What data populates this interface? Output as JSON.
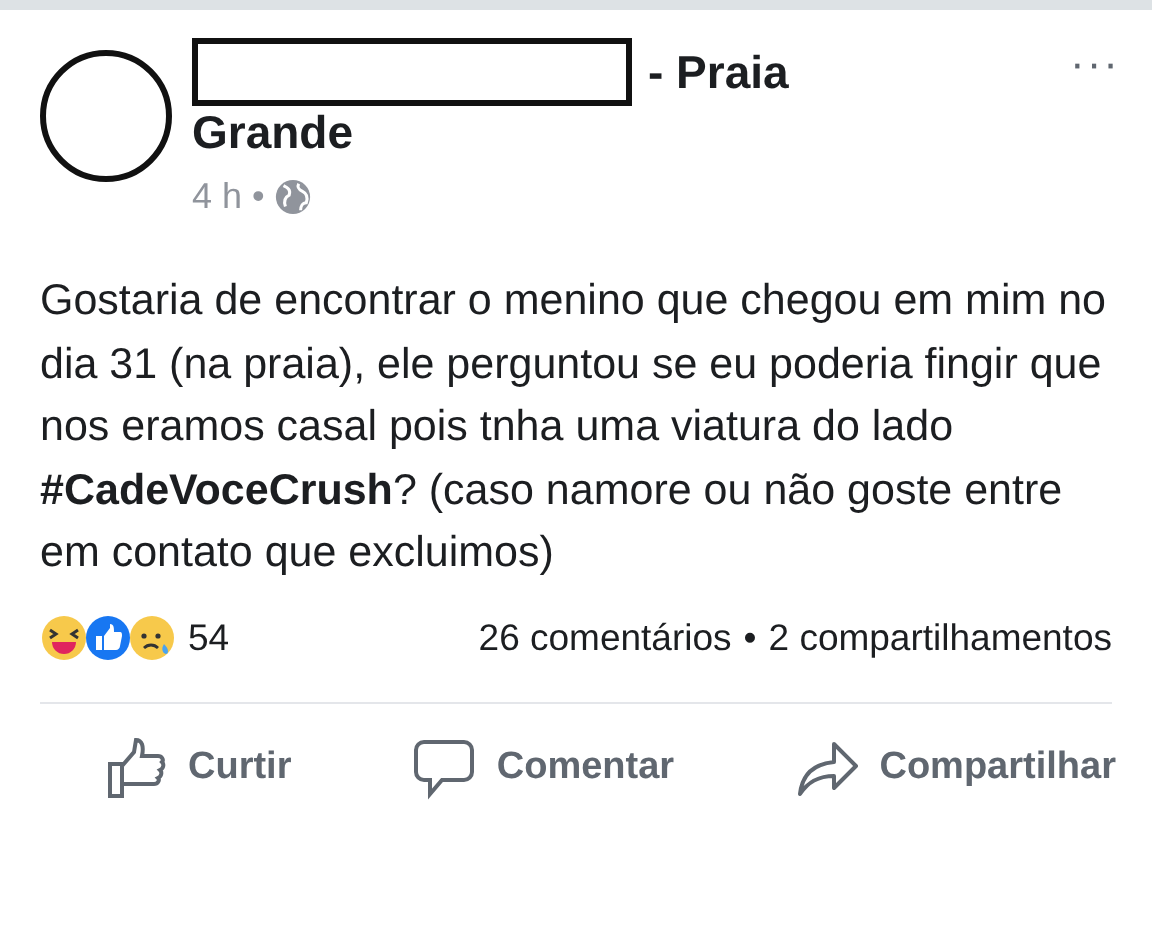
{
  "post": {
    "author_suffix": "- Praia",
    "author_line2": "Grande",
    "time": "4 h",
    "separator": "•",
    "more": "···",
    "text": "Gostaria de encontrar o menino que chegou em mim no dia 31 (na praia), ele perguntou se eu poderia fingir que nos eramos casal pois tnha uma viatura do lado **#CadeVoceCrush**? (caso namore ou não goste entre em contato que excluimos)",
    "reaction_count": "54",
    "comments": "26 comentários",
    "shares_separator": "•",
    "shares": "2 compartilhamentos"
  },
  "actions": [
    {
      "kind": "like",
      "label": "Curtir"
    },
    {
      "kind": "comment",
      "label": "Comentar"
    },
    {
      "kind": "share",
      "label": "Compartilhar"
    }
  ]
}
